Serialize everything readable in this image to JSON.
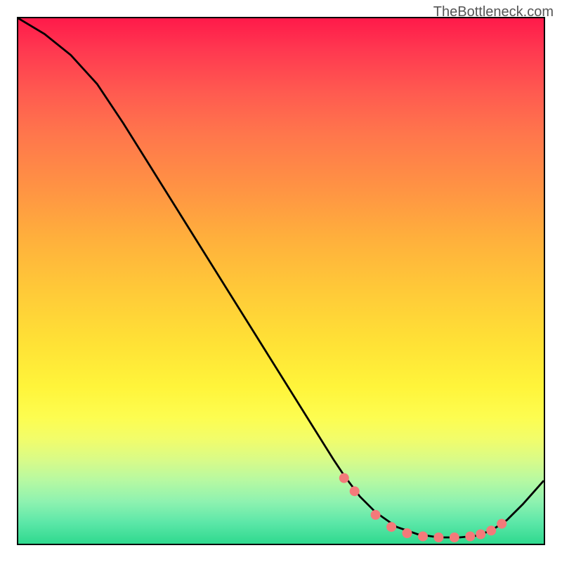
{
  "watermark": "TheBottleneck.com",
  "chart_data": {
    "type": "line",
    "title": "",
    "xlabel": "",
    "ylabel": "",
    "xlim": [
      0,
      100
    ],
    "ylim": [
      0,
      100
    ],
    "gradient_colors": {
      "top": "#ff1a4a",
      "mid": "#fff43a",
      "bottom": "#2fd98e"
    },
    "series": [
      {
        "name": "curve",
        "x": [
          0,
          5,
          10,
          15,
          20,
          25,
          30,
          35,
          40,
          45,
          50,
          55,
          60,
          62,
          65,
          68,
          72,
          76,
          80,
          84,
          87,
          90,
          93,
          96,
          100
        ],
        "y": [
          100,
          97,
          93,
          87.5,
          80,
          72,
          64,
          56,
          48,
          40,
          32,
          24,
          16,
          13,
          9,
          6,
          3.2,
          1.8,
          1.2,
          1.2,
          1.5,
          2.5,
          4.5,
          7.5,
          12
        ]
      },
      {
        "name": "dots",
        "x": [
          62,
          64,
          68,
          71,
          74,
          77,
          80,
          83,
          86,
          88,
          90,
          92
        ],
        "y": [
          12.5,
          10,
          5.5,
          3.2,
          2.0,
          1.4,
          1.2,
          1.2,
          1.4,
          1.8,
          2.5,
          3.8
        ]
      }
    ]
  }
}
